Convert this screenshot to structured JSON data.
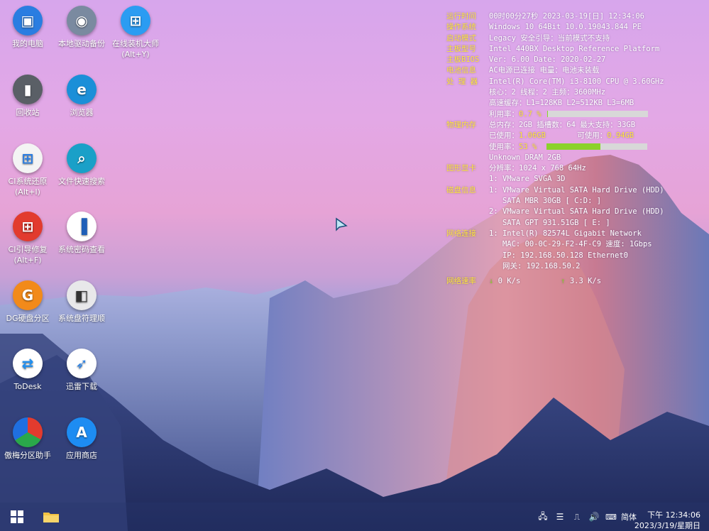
{
  "desktop_icons": [
    {
      "label": "我的电脑",
      "icon": "computer-icon",
      "color": "#2a7de1"
    },
    {
      "label": "本地驱动备份",
      "icon": "backup-drive-icon",
      "color": "#7a8aa0"
    },
    {
      "label": "在线装机大师",
      "label2": "(Alt+Y)",
      "icon": "windows-install-icon",
      "color": "#2b9cf2"
    },
    {
      "label": "回收站",
      "icon": "recycle-bin-icon",
      "color": "#5a5f66"
    },
    {
      "label": "浏览器",
      "icon": "edge-browser-icon",
      "color": "#1b8fd8"
    },
    {
      "label": "CI系统还原",
      "label2": "(Alt+I)",
      "icon": "system-restore-icon",
      "color": "#f4f4f4"
    },
    {
      "label": "文件快速搜索",
      "icon": "search-icon",
      "color": "#1aa0c8"
    },
    {
      "label": "CI引导修复",
      "label2": "(Alt+F)",
      "icon": "boot-repair-icon",
      "color": "#e23b2e"
    },
    {
      "label": "系统密码查看",
      "icon": "password-view-icon",
      "color": "#1f5fb8"
    },
    {
      "label": "DG硬盘分区",
      "icon": "disk-partition-icon",
      "color": "#f28a1a"
    },
    {
      "label": "系统盘符理顺",
      "icon": "drive-letter-icon",
      "color": "#e8e8ea"
    },
    {
      "label": "ToDesk",
      "icon": "todesk-icon",
      "color": "#1f8ff0"
    },
    {
      "label": "迅雷下载",
      "icon": "thunder-download-icon",
      "color": "#2b84e8"
    },
    {
      "label": "傲梅分区助手",
      "icon": "aomei-partition-icon",
      "color": "#f5f5f5"
    },
    {
      "label": "应用商店",
      "icon": "app-store-icon",
      "color": "#1d8cf2"
    }
  ],
  "sysinfo": {
    "uptime_key": "运行时间",
    "uptime": "00时00分27秒 2023-03-19[日] 12:34:06",
    "os_key": "操作系统",
    "os": "Windows 10 64Bit 10.0.19043.844 PE",
    "boot_key": "启动模式",
    "boot": "Legacy     安全引导：当前模式不支持",
    "board_key": "主板型号",
    "board": "Intel 440BX Desktop Reference Platform",
    "bios_key": "主板BIOS",
    "bios": "Ver: 6.00  Date: 2020-02-27",
    "battery_key": "电池信息",
    "battery": "AC电源已连接  电量：电池未装载",
    "cpu_key": "处 理 器",
    "cpu": "Intel(R) Core(TM) i3-8100 CPU @ 3.60GHz",
    "cpu_cores": "核心：2  线程：2       主频：3600MHz",
    "cpu_cache": "高速缓存：L1=128KB L2=512KB L3=6MB",
    "cpu_usage_label": "利用率：",
    "cpu_usage": "0.7 %",
    "cpu_usage_fraction": 0.007,
    "mem_key": "物理内存",
    "mem_total": "总内存：2GB 插槽数：64 最大支持：33GB",
    "mem_used_label": "已使用：",
    "mem_used": "1.06GB",
    "mem_free_label": "可使用：",
    "mem_free": "0.94GB",
    "mem_usage_label": "使用率：",
    "mem_usage": "53 %",
    "mem_usage_fraction": 0.53,
    "mem_module": "Unknown DRAM 2GB",
    "gpu_key": "图形显卡",
    "gpu_res": "分辨率：1024 x 768 64Hz",
    "gpu_name": "1: VMware SVGA 3D",
    "disk_key": "磁盘信息",
    "disk1": "1: VMware Virtual SATA Hard Drive (HDD)",
    "disk1_detail": "   SATA MBR 30GB [ C:D: ]",
    "disk2": "2: VMware Virtual SATA Hard Drive (HDD)",
    "disk2_detail": "   SATA GPT 931.51GB [ E: ]",
    "net_key": "网络连接",
    "net1": "1: Intel(R) 82574L Gigabit Network",
    "net_mac": "   MAC: 00-0C-29-F2-4F-C9 速度: 1Gbps",
    "net_ip": "   IP: 192.168.50.128 Ethernet0",
    "net_gw": "   网关: 192.168.50.2",
    "speed_key": "网络速率",
    "down_arrow": "↓",
    "down": "0 K/s",
    "up_arrow": "↑",
    "up": "3.3 K/s"
  },
  "taskbar": {
    "start": "start-icon",
    "explorer": "file-explorer-icon",
    "ime": "简体",
    "time": "下午 12:34:06",
    "date": "2023/3/19/星期日"
  },
  "colors": {
    "key_yellow": "#ffe83a",
    "bar_green": "#8bd22a"
  }
}
